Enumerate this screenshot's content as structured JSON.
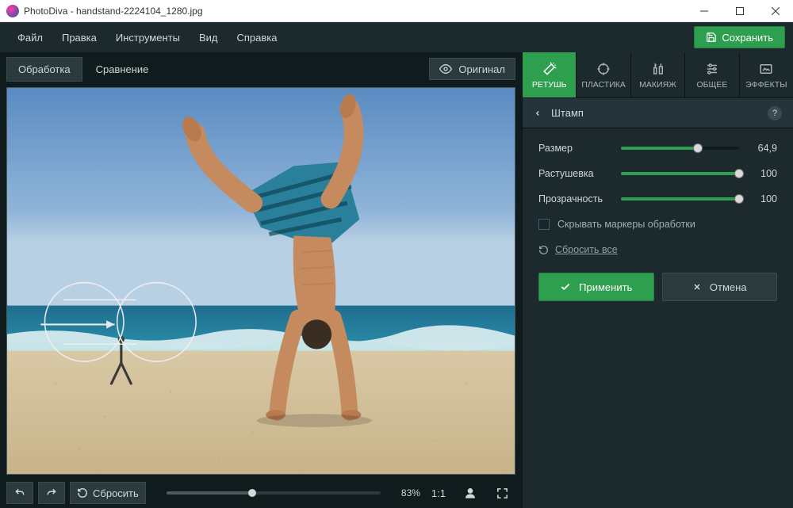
{
  "titlebar": {
    "app": "PhotoDiva",
    "file": "handstand-2224104_1280.jpg"
  },
  "menu": {
    "items": [
      "Файл",
      "Правка",
      "Инструменты",
      "Вид",
      "Справка"
    ],
    "save": "Сохранить"
  },
  "left_tabs": {
    "processing": "Обработка",
    "compare": "Сравнение",
    "original": "Оригинал"
  },
  "bottom": {
    "reset": "Сбросить",
    "zoom": "83%",
    "one_to_one": "1:1"
  },
  "toolcats": {
    "retouch": "РЕТУШЬ",
    "liquify": "ПЛАСТИКА",
    "makeup": "МАКИЯЖ",
    "general": "ОБЩЕЕ",
    "effects": "ЭФФЕКТЫ"
  },
  "panel": {
    "title": "Штамп",
    "size_label": "Размер",
    "feather_label": "Растушевка",
    "opacity_label": "Прозрачность",
    "size_value": "64,9",
    "feather_value": "100",
    "opacity_value": "100",
    "hide_markers": "Скрывать маркеры обработки",
    "reset_all": "Сбросить все",
    "apply": "Применить",
    "cancel": "Отмена"
  }
}
